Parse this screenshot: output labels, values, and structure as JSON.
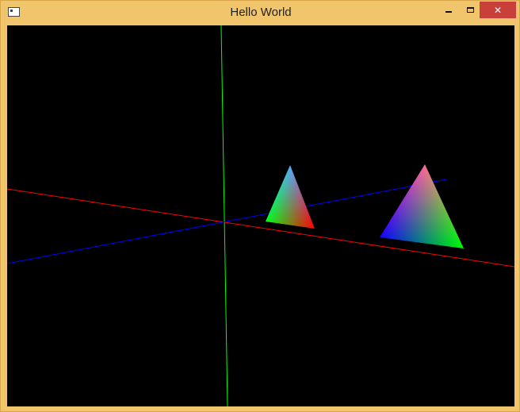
{
  "window": {
    "title": "Hello World",
    "controls": {
      "minimize": "minimize",
      "maximize": "maximize",
      "close": "✕"
    }
  },
  "canvas": {
    "background": "#000000",
    "axis_colors": {
      "x": "#ff0000",
      "y": "#00ff00",
      "z": "#0000ff"
    },
    "vertex_colors": [
      "#ff0000",
      "#00ff00",
      "#0000ff"
    ]
  }
}
